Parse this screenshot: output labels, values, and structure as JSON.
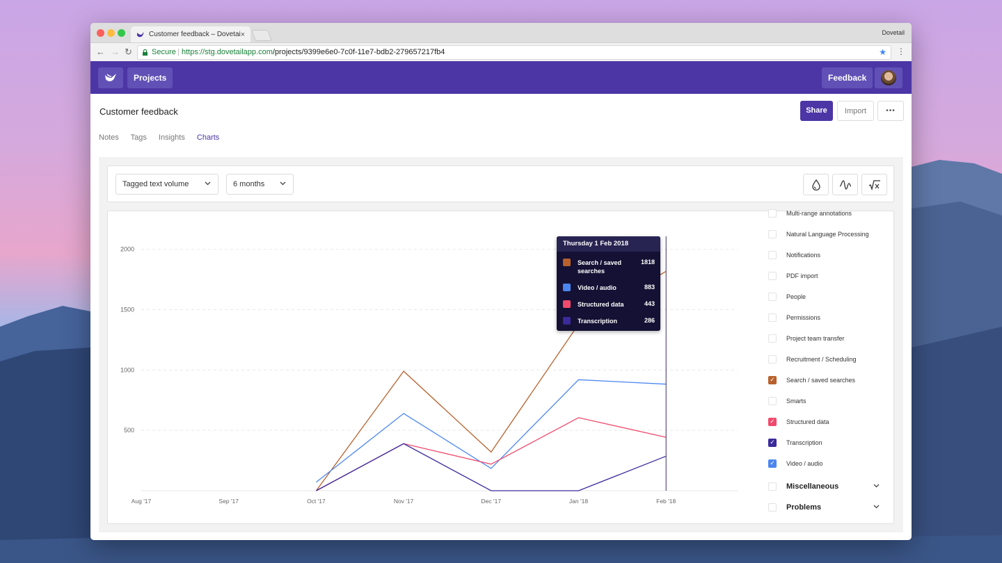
{
  "colors": {
    "brand": "#4c36a6",
    "search": "#b8612c",
    "video": "#4b86f0",
    "structured": "#f04a6c",
    "transcription": "#3a2a9a"
  },
  "browser": {
    "tab_title": "Customer feedback – Dovetail",
    "tab_close": "×",
    "profile": "Dovetail",
    "secure_label": "Secure",
    "url_scheme": "https://",
    "url_host": "stg.dovetailapp.com",
    "url_path": "/projects/9399e6e0-7c0f-11e7-bdb2-279657217fb4",
    "back_icon": "←",
    "forward_icon": "→",
    "reload_icon": "↻",
    "star_icon": "★",
    "menu_icon": "⋮",
    "lock_icon": "🔒"
  },
  "appbar": {
    "projects_label": "Projects",
    "feedback_label": "Feedback"
  },
  "page": {
    "title": "Customer feedback",
    "share_label": "Share",
    "import_label": "Import",
    "more_label": "•••",
    "tabs": [
      {
        "label": "Notes",
        "active": false
      },
      {
        "label": "Tags",
        "active": false
      },
      {
        "label": "Insights",
        "active": false
      },
      {
        "label": "Charts",
        "active": true
      }
    ]
  },
  "toolbar": {
    "metric_select": "Tagged text volume",
    "range_select": "6 months",
    "chev": "⌄",
    "icon_drop": "drop-icon",
    "icon_wave": "smooth-wave-icon",
    "icon_formula": "formula-icon"
  },
  "tooltip": {
    "date": "Thursday 1 Feb 2018",
    "rows": [
      {
        "label": "Search / saved searches",
        "value": "1818",
        "color": "#b8612c"
      },
      {
        "label": "Video / audio",
        "value": "883",
        "color": "#4b86f0"
      },
      {
        "label": "Structured data",
        "value": "443",
        "color": "#f04a6c"
      },
      {
        "label": "Transcription",
        "value": "286",
        "color": "#3a2a9a"
      }
    ]
  },
  "legend": {
    "items": [
      {
        "label": "Multi-range annotations",
        "checked": false
      },
      {
        "label": "Natural Language Processing",
        "checked": false
      },
      {
        "label": "Notifications",
        "checked": false
      },
      {
        "label": "PDF import",
        "checked": false
      },
      {
        "label": "People",
        "checked": false
      },
      {
        "label": "Permissions",
        "checked": false
      },
      {
        "label": "Project team transfer",
        "checked": false
      },
      {
        "label": "Recruitment / Scheduling",
        "checked": false
      },
      {
        "label": "Search / saved searches",
        "checked": true,
        "color": "#b8612c"
      },
      {
        "label": "Smarts",
        "checked": false
      },
      {
        "label": "Structured data",
        "checked": true,
        "color": "#f04a6c"
      },
      {
        "label": "Transcription",
        "checked": true,
        "color": "#3a2a9a"
      },
      {
        "label": "Video / audio",
        "checked": true,
        "color": "#4b86f0"
      }
    ],
    "groups": [
      {
        "label": "Miscellaneous"
      },
      {
        "label": "Problems"
      }
    ],
    "check_mark": "✓",
    "chev": "⌄"
  },
  "chart_data": {
    "type": "line",
    "categories": [
      "Aug '17",
      "Sep '17",
      "Oct '17",
      "Nov '17",
      "Dec '17",
      "Jan '18",
      "Feb '18"
    ],
    "ylim": [
      0,
      2200
    ],
    "yticks": [
      500,
      1000,
      1500,
      2000
    ],
    "grid": true,
    "series": [
      {
        "name": "Search / saved searches",
        "color": "#b8612c",
        "values": [
          null,
          null,
          0,
          990,
          320,
          1380,
          1818
        ]
      },
      {
        "name": "Video / audio",
        "color": "#4b86f0",
        "values": [
          null,
          null,
          70,
          640,
          185,
          920,
          883
        ]
      },
      {
        "name": "Structured data",
        "color": "#f04a6c",
        "values": [
          null,
          null,
          0,
          390,
          220,
          605,
          443
        ]
      },
      {
        "name": "Transcription",
        "color": "#3a2a9a",
        "values": [
          null,
          null,
          0,
          390,
          0,
          0,
          286
        ]
      }
    ],
    "hover_index": 6
  }
}
